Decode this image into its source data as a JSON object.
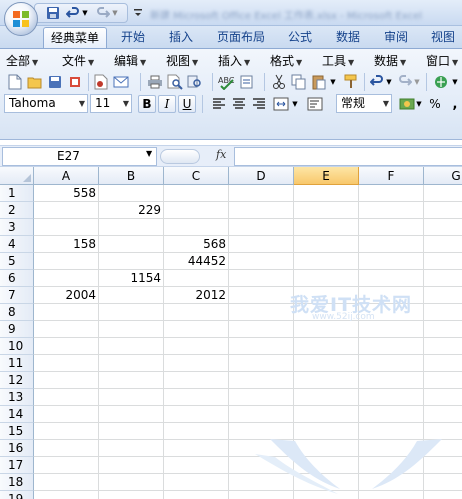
{
  "title_bar": {
    "blurred_title": "新建 Microsoft Office Excel 工作表.xlsx - Microsoft Excel"
  },
  "tabs": [
    {
      "label": "经典菜单",
      "active": true
    },
    {
      "label": "开始",
      "active": false
    },
    {
      "label": "插入",
      "active": false
    },
    {
      "label": "页面布局",
      "active": false
    },
    {
      "label": "公式",
      "active": false
    },
    {
      "label": "数据",
      "active": false
    },
    {
      "label": "审阅",
      "active": false
    },
    {
      "label": "视图",
      "active": false
    }
  ],
  "menu": [
    "全部",
    "文件",
    "编辑",
    "视图",
    "插入",
    "格式",
    "工具",
    "数据",
    "窗口"
  ],
  "formatting": {
    "font_name": "Tahoma",
    "font_size": "11",
    "bold": "B",
    "italic": "I",
    "underline": "U",
    "number_format": "常规",
    "percent": "%"
  },
  "formula_bar": {
    "name_box": "E27",
    "fx_label": "fx",
    "formula": ""
  },
  "grid": {
    "selected_column": "E",
    "columns": [
      "A",
      "B",
      "C",
      "D",
      "E",
      "F",
      "G"
    ],
    "rows": [
      "1",
      "2",
      "3",
      "4",
      "5",
      "6",
      "7",
      "8",
      "9",
      "10",
      "11",
      "12",
      "13",
      "14",
      "15",
      "16",
      "17",
      "18",
      "19"
    ],
    "cells": {
      "A1": "558",
      "B2": "229",
      "A4": "158",
      "C4": "568",
      "C5": "44452",
      "B6": "1154",
      "A7": "2004",
      "C7": "2012"
    }
  },
  "watermark": {
    "text": "我爱IT技术网",
    "url": "www.52ij.com"
  },
  "colors": {
    "accent": "#15428b",
    "selected_header": "#f8c86c",
    "grid_line": "#dadcdd",
    "header_border": "#9eb6ce"
  }
}
